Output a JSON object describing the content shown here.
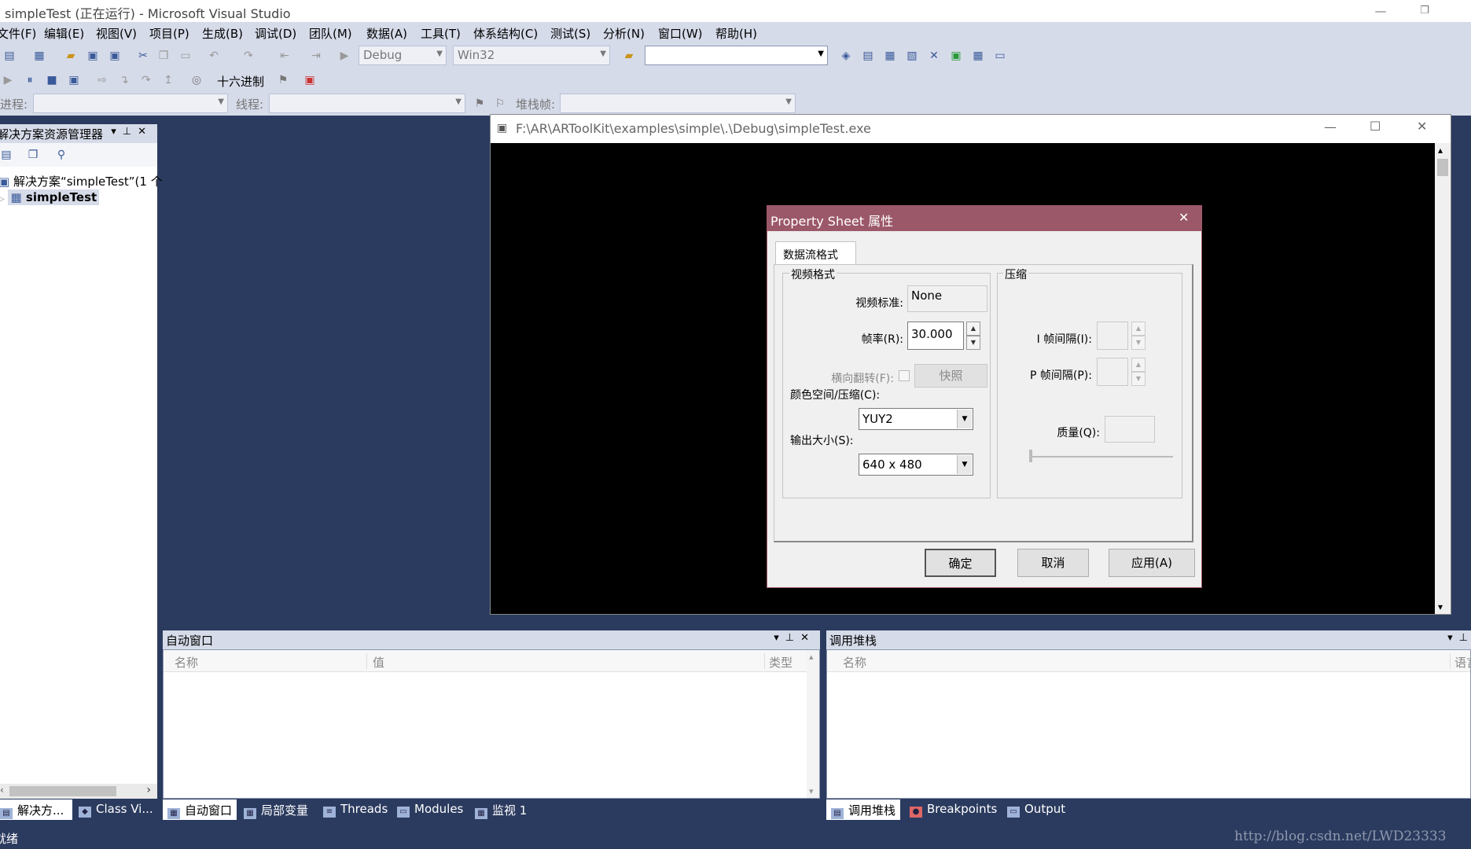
{
  "window": {
    "title": "simpleTest (正在运行) - Microsoft Visual Studio",
    "min": "—",
    "max": "❐",
    "close": "✕"
  },
  "menu": [
    "文件(F)",
    "编辑(E)",
    "视图(V)",
    "项目(P)",
    "生成(B)",
    "调试(D)",
    "团队(M)",
    "数据(A)",
    "工具(T)",
    "体系结构(C)",
    "测试(S)",
    "分析(N)",
    "窗口(W)",
    "帮助(H)"
  ],
  "toolbar1": {
    "config": "Debug",
    "platform": "Win32",
    "find": ""
  },
  "toolbar2": {
    "hex": "十六进制"
  },
  "toolbar3": {
    "process_label": "进程:",
    "thread_label": "线程:",
    "stackframe_label": "堆栈帧:"
  },
  "solution_explorer": {
    "title": "解决方案资源管理器",
    "solution": "解决方案“simpleTest”(1 个",
    "project": "simpleTest"
  },
  "app_window": {
    "title": "F:\\AR\\ARToolKit\\examples\\simple\\.\\Debug\\simpleTest.exe"
  },
  "dialog": {
    "title": "Property Sheet 属性",
    "tab": "数据流格式",
    "video_group": "视频格式",
    "compress_group": "压缩",
    "standard_label": "视频标准:",
    "standard_value": "None",
    "fps_label": "帧率(R):",
    "fps_value": "30.000",
    "flip_label": "横向翻转(F):",
    "snapshot": "快照",
    "colorspace_label": "颜色空间/压缩(C):",
    "colorspace_value": "YUY2",
    "outsize_label": "输出大小(S):",
    "outsize_value": "640 x 480",
    "iframe_label": "I 帧间隔(I):",
    "pframe_label": "P 帧间隔(P):",
    "quality_label": "质量(Q):",
    "ok": "确定",
    "cancel": "取消",
    "apply": "应用(A)"
  },
  "autos": {
    "title": "自动窗口",
    "col_name": "名称",
    "col_value": "值",
    "col_type": "类型"
  },
  "callstack": {
    "title": "调用堆栈",
    "col_name": "名称",
    "col_lang": "语言"
  },
  "left_tabs": [
    "解决方...",
    "Class Vi..."
  ],
  "bottom_tabs": [
    "自动窗口",
    "局部变量",
    "Threads",
    "Modules",
    "监视 1"
  ],
  "right_tabs": [
    "调用堆栈",
    "Breakpoints",
    "Output"
  ],
  "status": "就绪",
  "watermark": "http://blog.csdn.net/LWD23333"
}
